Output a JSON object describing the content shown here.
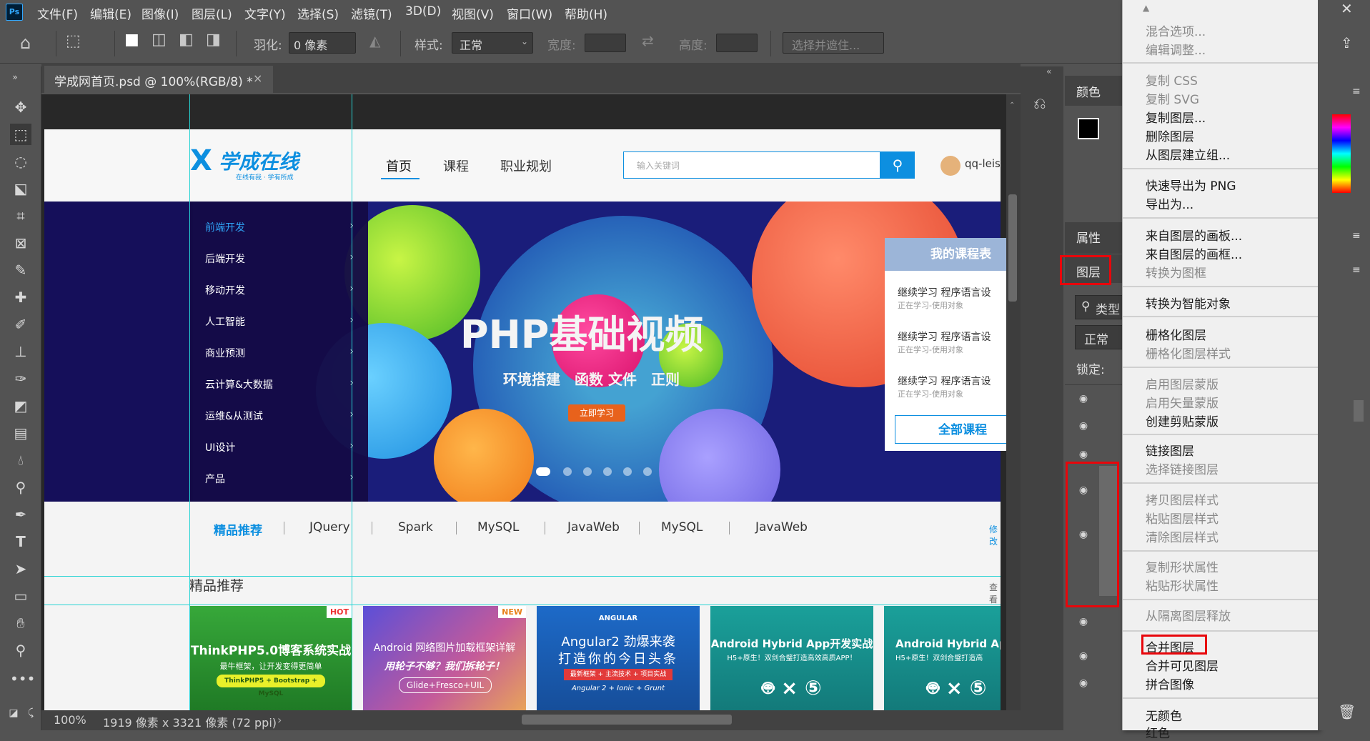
{
  "app": {
    "logo": "Ps"
  },
  "menubar": [
    "文件(F)",
    "编辑(E)",
    "图像(I)",
    "图层(L)",
    "文字(Y)",
    "选择(S)",
    "滤镜(T)",
    "3D(D)",
    "视图(V)",
    "窗口(W)",
    "帮助(H)"
  ],
  "options": {
    "feather_label": "羽化:",
    "feather_value": "0 像素",
    "style_label": "样式:",
    "style_value": "正常",
    "width_label": "宽度:",
    "height_label": "高度:",
    "select_mask_label": "选择并遮住..."
  },
  "document": {
    "tab_title": "学成网首页.psd @ 100%(RGB/8) *",
    "zoom": "100%",
    "size_info": "1919 像素 x 3321 像素 (72 ppi)"
  },
  "site": {
    "logo_text": "学成在线",
    "logo_sub": "在线有我 · 学有所成",
    "nav": [
      "首页",
      "课程",
      "职业规划"
    ],
    "search_placeholder": "输入关键词",
    "user": "qq-leis",
    "categories": [
      "前端开发",
      "后端开发",
      "移动开发",
      "人工智能",
      "商业预测",
      "云计算&大数据",
      "运维&从测试",
      "UI设计",
      "产品"
    ],
    "banner_title": "PHP基础视频",
    "banner_sub": "环境搭建　函数 文件　正则",
    "banner_btn": "立即学习",
    "course_card_title": "我的课程表",
    "course_items": [
      {
        "title": "继续学习 程序语言设",
        "sub": "正在学习-使用对象"
      },
      {
        "title": "继续学习 程序语言设",
        "sub": "正在学习-使用对象"
      },
      {
        "title": "继续学习 程序语言设",
        "sub": "正在学习-使用对象"
      }
    ],
    "all_courses": "全部课程",
    "subnav": [
      "精品推荐",
      "JQuery",
      "Spark",
      "MySQL",
      "JavaWeb",
      "MySQL",
      "JavaWeb"
    ],
    "subnav_more": "修改",
    "section_title": "精品推荐",
    "section_more": "查看",
    "cards": [
      {
        "title": "ThinkPHP5.0博客系统实战",
        "line2": "最牛框架，让开发变得更简单",
        "line3": "ThinkPHP5 + Bootstrap + MySQL",
        "badge": "HOT",
        "bg": "#2f8a2c"
      },
      {
        "title": "Android 网络图片加载框架详解",
        "line2": "用轮子不够？我们拆轮子！",
        "line3": "Glide+Fresco+UIL",
        "badge": "NEW",
        "bg": "#6a4fc4"
      },
      {
        "title": "Angular2 劲爆来袭",
        "line2": "打造你的今日头条",
        "line3": "最新框架 + 主流技术 + 项目实战",
        "line4": "Angular 2 + Ionic + Grunt",
        "brand": "ANGULAR",
        "bg": "#1b5fb0"
      },
      {
        "title": "Android Hybrid App开发实战",
        "line2": "H5+原生！双剑合璧打造高效高质APP！",
        "bg": "#1a8a8a"
      },
      {
        "title": "Android Hybrid App开",
        "line2": "H5+原生！双剑合璧打造高",
        "bg": "#1a8a8a"
      }
    ]
  },
  "panels": {
    "color_tab": "颜色",
    "props_tab": "属性",
    "layers_tab": "图层",
    "filter_kind": "类型",
    "blend_mode": "正常",
    "lock_label": "锁定:"
  },
  "context_menu": {
    "items": [
      {
        "label": "混合选项...",
        "disabled": true
      },
      {
        "label": "编辑调整...",
        "disabled": true
      },
      {
        "sep": true
      },
      {
        "label": "复制 CSS",
        "disabled": true
      },
      {
        "label": "复制 SVG",
        "disabled": true
      },
      {
        "label": "复制图层...",
        "disabled": false
      },
      {
        "label": "删除图层",
        "disabled": false
      },
      {
        "label": "从图层建立组...",
        "disabled": false
      },
      {
        "sep": true
      },
      {
        "label": "快速导出为 PNG",
        "disabled": false
      },
      {
        "label": "导出为...",
        "disabled": false
      },
      {
        "sep": true
      },
      {
        "label": "来自图层的画板...",
        "disabled": false
      },
      {
        "label": "来自图层的画框...",
        "disabled": false
      },
      {
        "label": "转换为图框",
        "disabled": true
      },
      {
        "sep": true
      },
      {
        "label": "转换为智能对象",
        "disabled": false
      },
      {
        "sep": true
      },
      {
        "label": "栅格化图层",
        "disabled": false
      },
      {
        "label": "栅格化图层样式",
        "disabled": true
      },
      {
        "sep": true
      },
      {
        "label": "启用图层蒙版",
        "disabled": true
      },
      {
        "label": "启用矢量蒙版",
        "disabled": true
      },
      {
        "label": "创建剪贴蒙版",
        "disabled": false
      },
      {
        "sep": true
      },
      {
        "label": "链接图层",
        "disabled": false
      },
      {
        "label": "选择链接图层",
        "disabled": true
      },
      {
        "sep": true
      },
      {
        "label": "拷贝图层样式",
        "disabled": true
      },
      {
        "label": "粘贴图层样式",
        "disabled": true
      },
      {
        "label": "清除图层样式",
        "disabled": true
      },
      {
        "sep": true
      },
      {
        "label": "复制形状属性",
        "disabled": true
      },
      {
        "label": "粘贴形状属性",
        "disabled": true
      },
      {
        "sep": true
      },
      {
        "label": "从隔离图层释放",
        "disabled": true
      },
      {
        "sep": true
      },
      {
        "label": "合并图层",
        "disabled": false,
        "highlighted": true
      },
      {
        "label": "合并可见图层",
        "disabled": false
      },
      {
        "label": "拼合图像",
        "disabled": false
      },
      {
        "sep": true
      },
      {
        "label": "无颜色",
        "disabled": false
      },
      {
        "label": "红色",
        "disabled": false
      }
    ]
  },
  "colors": {
    "highlight_box": "#e8060b",
    "guide": "#27d3d3",
    "brand_blue": "#0d8fe0"
  }
}
